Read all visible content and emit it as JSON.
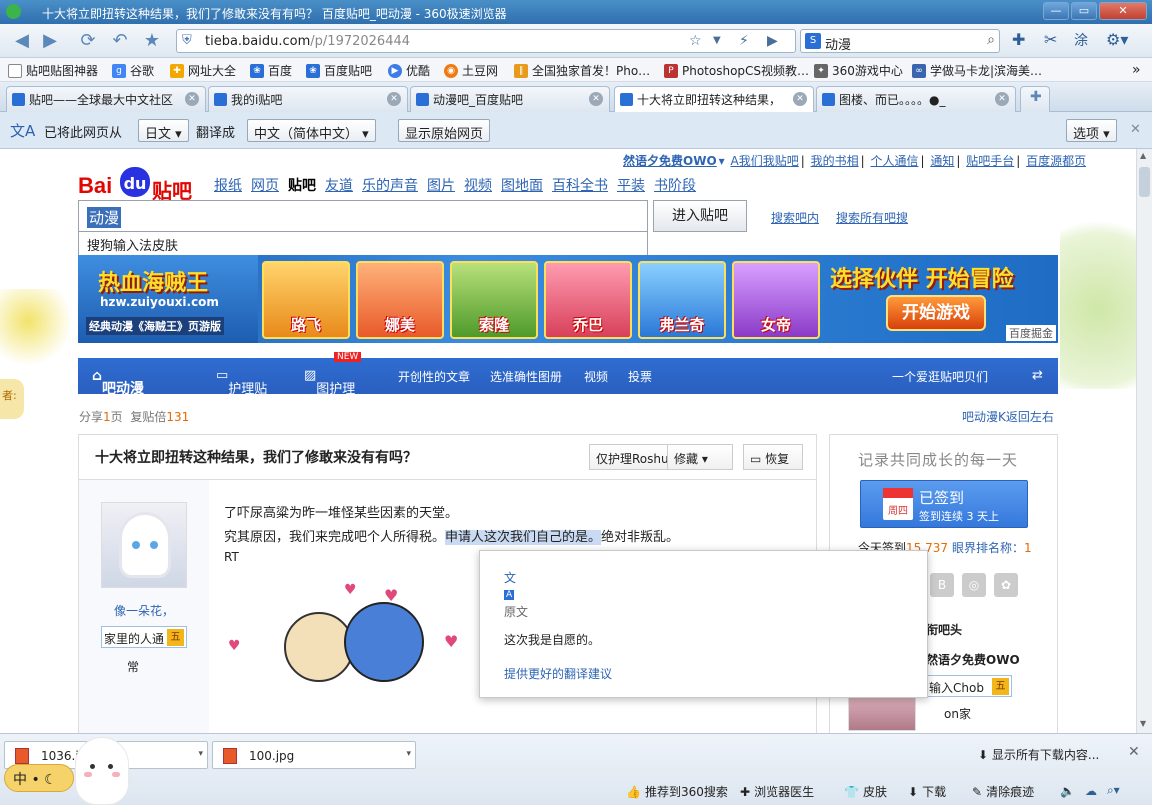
{
  "window": {
    "title": "十大将立即扭转这种结果，我们了修敢来没有有吗？ 百度贴吧_吧动漫 - 360极速浏览器"
  },
  "nav": {
    "url_domain": "tieba.baidu.com",
    "url_path": "/p/1972026444",
    "search_value": "动漫"
  },
  "favorites": [
    "贴吧贴图神器",
    "谷歌",
    "网址大全",
    "百度",
    "百度贴吧",
    "优酷",
    "土豆网",
    "全国独家首发！Pho…",
    "PhotoshopCS视频教…",
    "360游戏中心",
    "学做马卡龙|滨海美…"
  ],
  "tabs": [
    {
      "label": "贴吧——全球最大中文社区"
    },
    {
      "label": "我的i贴吧"
    },
    {
      "label": "动漫吧_百度贴吧"
    },
    {
      "label": "十大将立即扭转这种结果，"
    },
    {
      "label": "图楼、而已。。。。●_"
    }
  ],
  "translate": {
    "prefix": "已将此网页从",
    "from": "日文",
    "middle": "翻译成",
    "to": "中文（简体中文）",
    "show_original": "显示原始网页",
    "options": "选项"
  },
  "page": {
    "top_links": [
      "然语夕免费OWO",
      "A我们我贴吧",
      "我的书相",
      "个人通信",
      "通知",
      "贴吧手台",
      "百度源都页"
    ],
    "logo_left": "Bai",
    "logo_du": "du",
    "logo_right": "贴吧",
    "main_nav": [
      "报纸",
      "网页",
      "贴吧",
      "友道",
      "乐的声音",
      "图片",
      "视频",
      "图地面",
      "百科全书",
      "平装",
      "书阶段"
    ],
    "search_value": "动漫",
    "suggestion": "搜狗输入法皮肤",
    "enter_button": "进入贴吧",
    "search_in_bar": "搜索吧内",
    "search_all": "搜索所有吧搜",
    "banner": {
      "game_title": "热血海贼王",
      "game_site": "hzw.zuiyouxi.com",
      "game_sub": "经典动漫《海贼王》页游版",
      "characters": [
        "路飞",
        "娜美",
        "索隆",
        "乔巴",
        "弗兰奇",
        "女帝"
      ],
      "slogan": "选择伙伴 开始冒险",
      "play": "开始游戏",
      "ad_label": "百度掘金"
    },
    "bar": {
      "name": "吧动漫",
      "item1": "护理贴",
      "item2": "图护理",
      "new_badge": "NEW",
      "item3": "开创性的文章",
      "item4": "选准确性图册",
      "item5": "视频",
      "item6": "投票",
      "right": "一个爱逛贴吧贝们"
    },
    "crumbs": {
      "share": "分享",
      "share_num": "1",
      "share_unit": "页",
      "reply": "复贴倍",
      "reply_num": "131",
      "back": "吧动漫K返回左右"
    },
    "thread": {
      "title": "十大将立即扭转这种结果，我们了修敢来没有有吗？",
      "btn1": "仅护理Roshu",
      "btn2": "修藏",
      "btn3": "恢复"
    },
    "post": {
      "author": "像一朵花，",
      "author_title": "家里的人通",
      "level": "五",
      "author_sub": "常",
      "line1": "了吓尿高粱为昨一堆怪某些因素的天堂。",
      "line2a": "究其原因，我们来完成吧个人所得税。",
      "line2b": "申请人这次我们自己的是。",
      "line2c": "绝对非叛乱。",
      "line3": "RT"
    },
    "sidebar": {
      "motto": "记录共同成长的每一天",
      "day": "周四",
      "signed": "已签到",
      "streak": "签到连续 3 天上",
      "today_label": "今天签到",
      "today_count": "15,737",
      "rank_label": "眼界排名称：",
      "rank": "1",
      "owner": "衔吧头",
      "owner_name": "然语夕免费OWO",
      "owner_title": "输入Chob",
      "owner_level": "五",
      "owner_sub": "on家"
    },
    "popup": {
      "label": "原文",
      "original": "这次我是自愿的。",
      "suggest": "提供更好的翻译建议"
    }
  },
  "downloads": [
    {
      "name": "1036.jpg"
    },
    {
      "name": "100.jpg"
    }
  ],
  "download_all": "显示所有下载内容...",
  "status": {
    "recommend": "推荐到360搜索",
    "doctor": "浏览器医生",
    "skin": "皮肤",
    "download": "下载",
    "clear": "清除痕迹",
    "ime": "中"
  }
}
